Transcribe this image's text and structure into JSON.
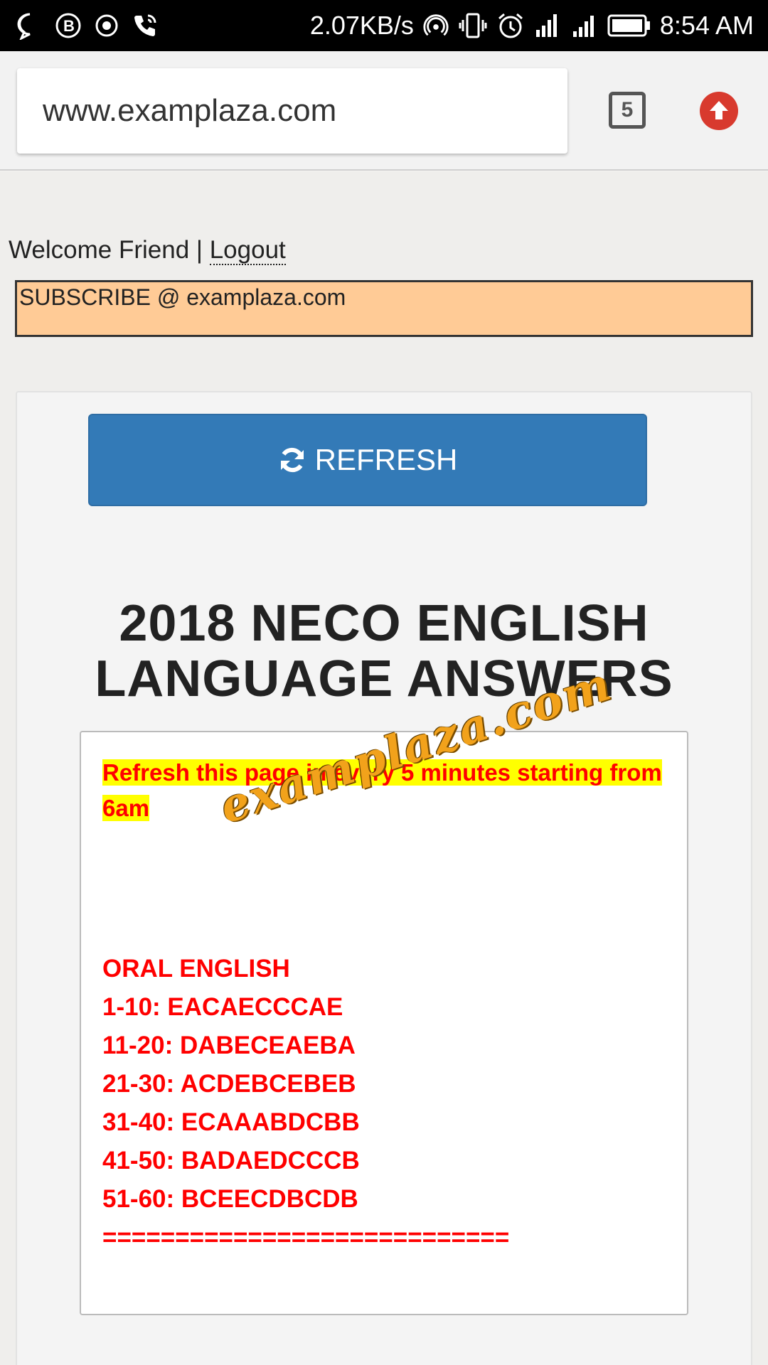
{
  "status_bar": {
    "speed": "2.07KB/s",
    "time": "8:54 AM"
  },
  "browser": {
    "url": "www.examplaza.com",
    "tab_count": "5"
  },
  "page": {
    "welcome": "Welcome Friend | ",
    "logout": "Logout",
    "subscribe": "SUBSCRIBE @ examplaza.com",
    "refresh_label": "REFRESH",
    "title_line1": "2018 NECO ENGLISH",
    "title_line2": "LANGUAGE ANSWERS",
    "watermark": "examplaza.com",
    "notice": "Refresh this page in every 5 minutes starting from 6am",
    "answers": [
      "ORAL ENGLISH",
      "1-10: EACAECCCAE",
      "11-20: DABECEAEBA",
      "21-30: ACDEBCEBEB",
      "31-40: ECAAABDCBB",
      "41-50: BADAEDCCCB",
      "51-60: BCEECDBCDB",
      "============================"
    ]
  }
}
